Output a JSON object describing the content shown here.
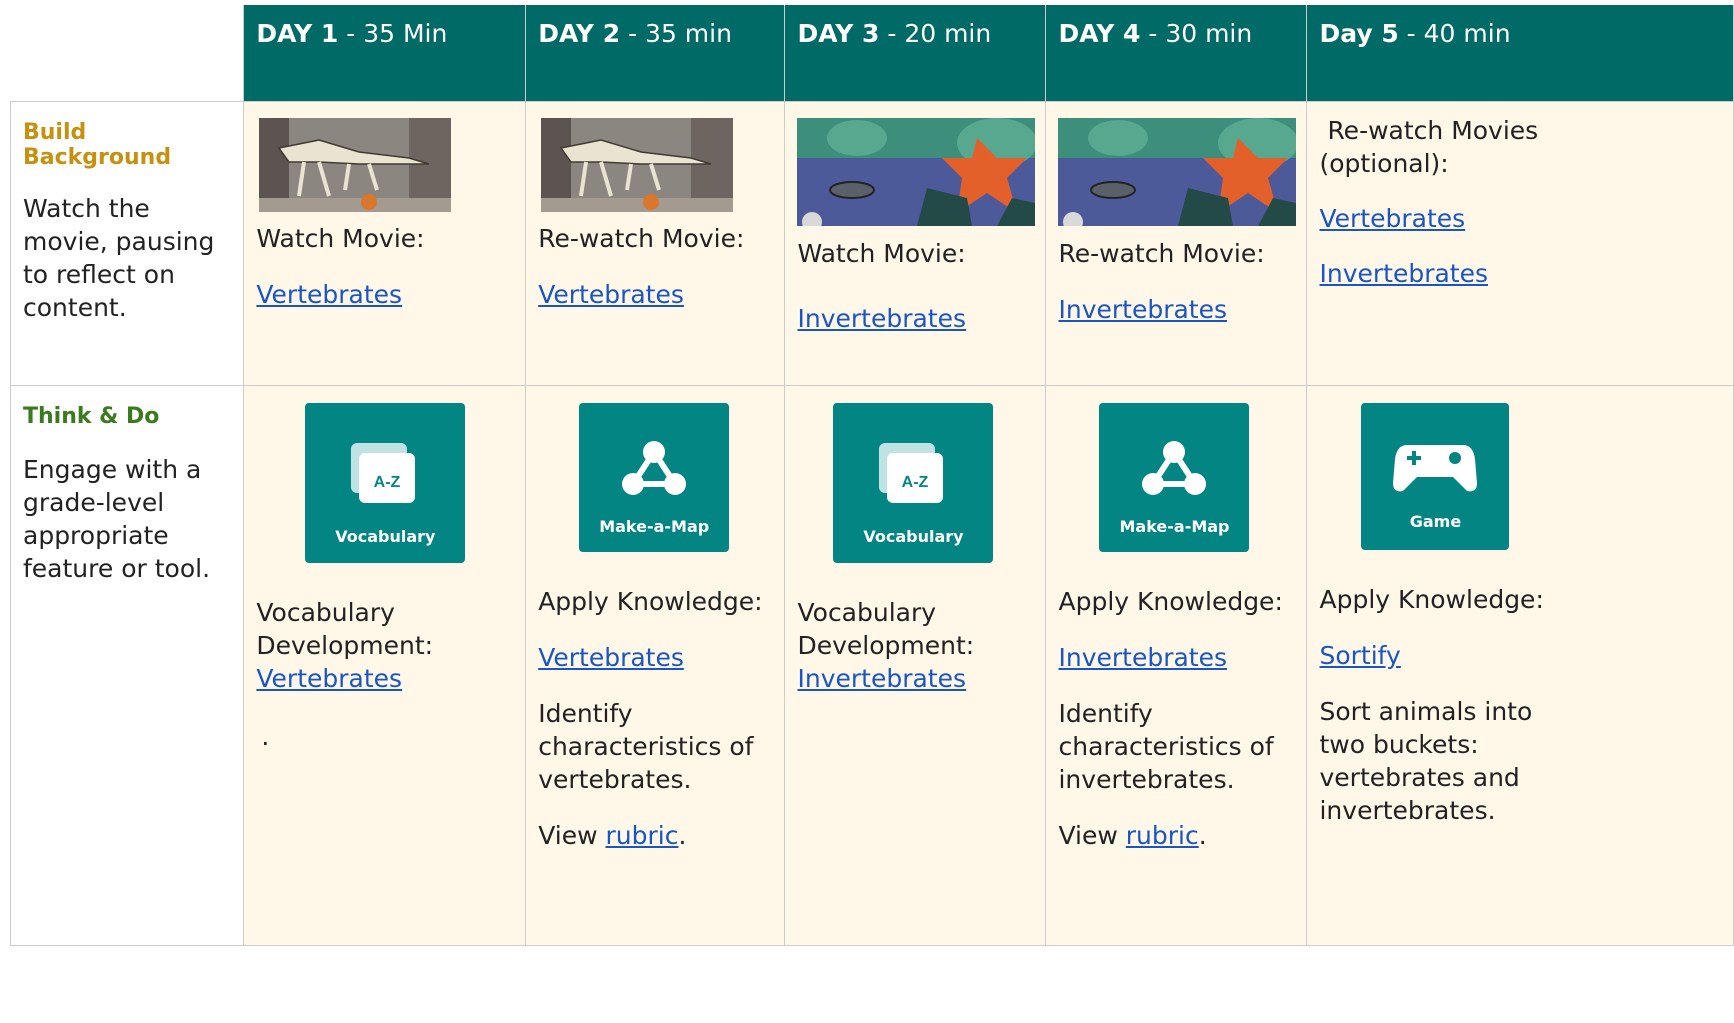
{
  "header": {
    "days": [
      {
        "day": "DAY 1",
        "dur": " - 35 Min"
      },
      {
        "day": "DAY 2",
        "dur": " - 35 min"
      },
      {
        "day": "DAY 3",
        "dur": " - 20 min"
      },
      {
        "day": "DAY 4",
        "dur": " - 30 min"
      },
      {
        "day": "Day 5",
        "dur": " - 40 min"
      }
    ]
  },
  "build": {
    "title": "Build Background",
    "desc": "Watch the movie, pausing to reflect on content.",
    "cells": [
      {
        "text": "Watch Movie:",
        "link": "Vertebrates"
      },
      {
        "text": "Re-watch Movie:",
        "link": "Vertebrates"
      },
      {
        "text": "Watch Movie:",
        "link": "Invertebrates"
      },
      {
        "text": "Re-watch Movie:",
        "link": "Invertebrates"
      },
      {
        "text": " Re-watch Movies (optional):",
        "link1": "Vertebrates",
        "link2": "Invertebrates"
      }
    ]
  },
  "think": {
    "title": "Think & Do",
    "desc": "Engage with a grade-level appropriate feature or tool.",
    "cells": [
      {
        "tile": "Vocabulary",
        "text": "Vocabulary Development:",
        "link": "Vertebrates",
        "note": "."
      },
      {
        "tile": "Make-a-Map",
        "text": "Apply Knowledge:",
        "link": "Vertebrates",
        "desc": "Identify characteristics of vertebrates.",
        "view": "View ",
        "rubric": "rubric",
        "end": "."
      },
      {
        "tile": "Vocabulary",
        "text": "Vocabulary Development:",
        "link": "Invertebrates"
      },
      {
        "tile": "Make-a-Map",
        "text": "Apply Knowledge:",
        "link": "Invertebrates",
        "desc": "Identify characteristics of invertebrates.",
        "view": "View ",
        "rubric": "rubric",
        "end": "."
      },
      {
        "tile": "Game",
        "text": "Apply Knowledge:",
        "link": "Sortify",
        "desc": "Sort animals into two buckets: vertebrates and invertebrates."
      }
    ]
  },
  "icons": {
    "az": "A-Z"
  },
  "colors": {
    "header": "#006b66",
    "tile": "#038584",
    "cell": "#fff7e8",
    "link": "#1a55c7"
  }
}
